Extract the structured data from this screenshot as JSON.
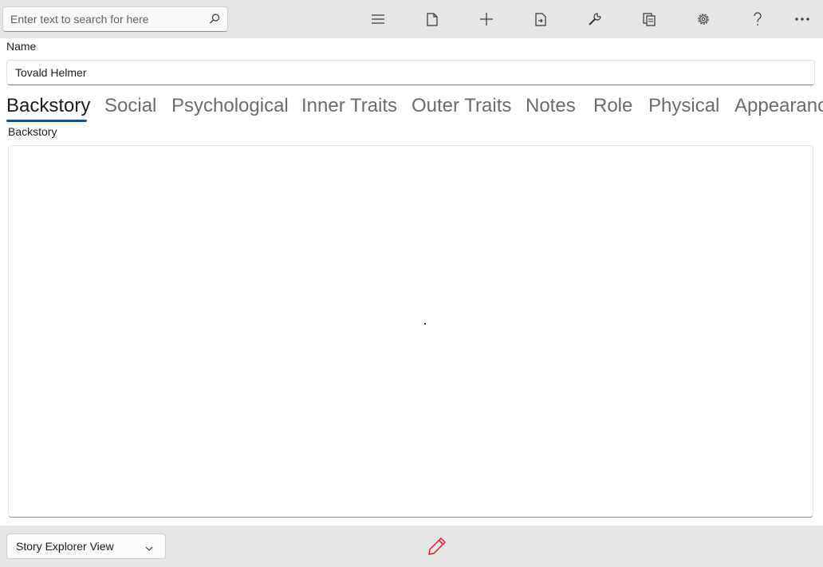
{
  "toolbar": {
    "search_placeholder": "Enter text to search for here",
    "icons": [
      "menu-icon",
      "new-file-icon",
      "add-icon",
      "export-icon",
      "tools-icon",
      "copy-icon",
      "settings-icon",
      "help-icon",
      "more-icon"
    ]
  },
  "form": {
    "name_label": "Name",
    "name_value": "Tovald Helmer"
  },
  "tabs": [
    {
      "label": "Backstory"
    },
    {
      "label": "Social"
    },
    {
      "label": "Psychological"
    },
    {
      "label": "Inner Traits"
    },
    {
      "label": "Outer Traits"
    },
    {
      "label": "Notes"
    },
    {
      "label": "Role"
    },
    {
      "label": "Physical"
    },
    {
      "label": "Appearance"
    }
  ],
  "active_tab": "Backstory",
  "section": {
    "label": "Backstory",
    "content": ""
  },
  "footer": {
    "view_select": "Story Explorer View"
  },
  "colors": {
    "accent": "#005a9e",
    "edit_icon": "#e81123",
    "bar_background": "#e6e6e6"
  }
}
